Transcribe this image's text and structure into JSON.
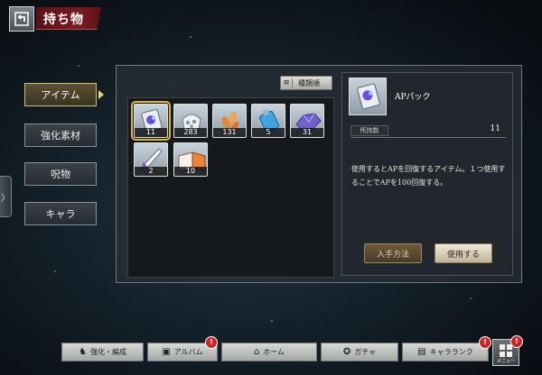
{
  "header": {
    "title": "持ち物",
    "back_icon": "back-arrow-icon"
  },
  "tabs": [
    {
      "label": "アイテム",
      "active": true
    },
    {
      "label": "強化素材",
      "active": false
    },
    {
      "label": "呪物",
      "active": false
    },
    {
      "label": "キャラ",
      "active": false
    }
  ],
  "side_handle": {
    "glyph": "〉"
  },
  "inventory": {
    "sort_label": "種類順",
    "items": [
      {
        "icon": "ap-pack-icon",
        "qty": "11",
        "selected": true
      },
      {
        "icon": "gem-pouch-icon",
        "qty": "283"
      },
      {
        "icon": "orange-crystal-icon",
        "qty": "131"
      },
      {
        "icon": "blue-potion-icon",
        "qty": "5"
      },
      {
        "icon": "purple-ore-icon",
        "qty": "31"
      },
      {
        "icon": "dagger-icon",
        "qty": "2"
      },
      {
        "icon": "orange-book-icon",
        "qty": "10"
      }
    ]
  },
  "detail": {
    "name": "APパック",
    "held_label": "所持数",
    "held_value": "11",
    "description": "使用するとAPを回復するアイテム。１つ使用することでAPを100回復する。",
    "obtain_button": "入手方法",
    "use_button": "使用する"
  },
  "bottom_nav": [
    {
      "label": "強化・編成",
      "icon": "enhance-icon",
      "badge": ""
    },
    {
      "label": "アルバム",
      "icon": "album-icon",
      "badge": "!"
    },
    {
      "label": "ホーム",
      "icon": "home-icon",
      "badge": ""
    },
    {
      "label": "ガチャ",
      "icon": "gacha-icon",
      "badge": ""
    },
    {
      "label": "キャラランク",
      "icon": "rank-icon",
      "badge": "!"
    }
  ],
  "menu": {
    "label": "メニュー",
    "badge": "!"
  },
  "colors": {
    "accent_gold": "#d8b643",
    "title_red": "#7a1a22",
    "badge_red": "#c9262b"
  }
}
